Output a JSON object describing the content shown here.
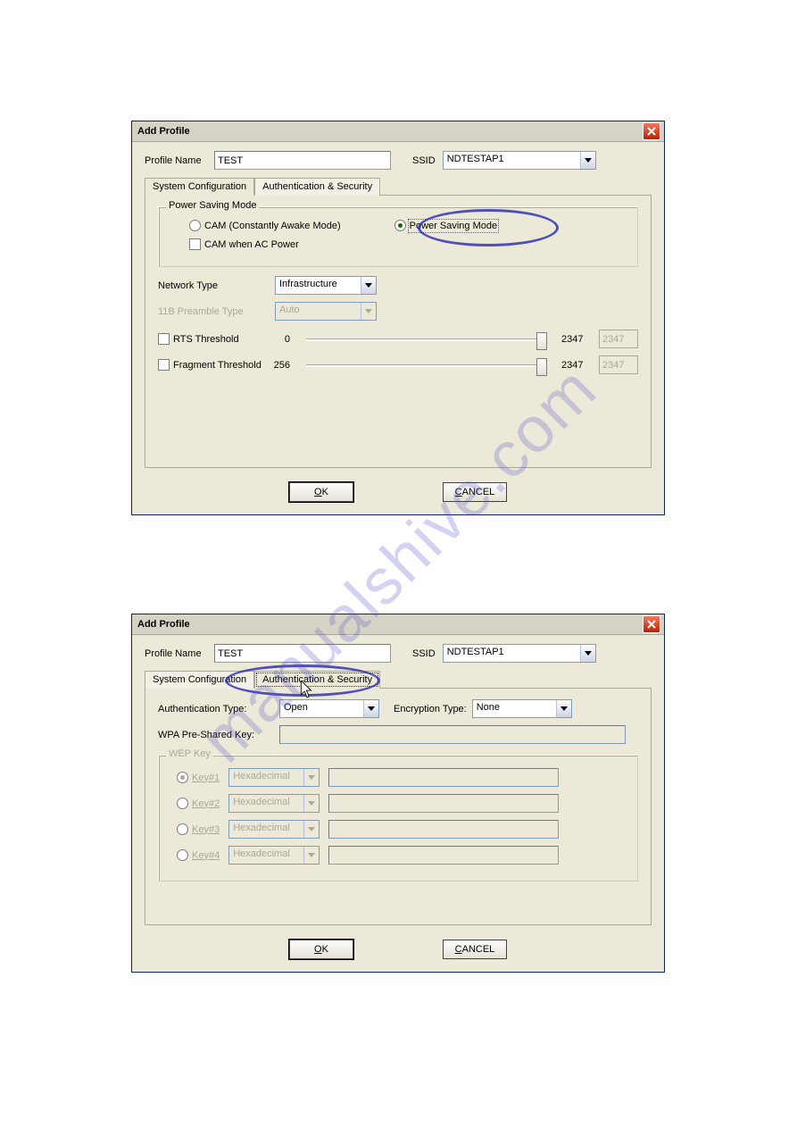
{
  "watermark": "manualshive.com",
  "dialog1": {
    "title": "Add Profile",
    "profile_name_label": "Profile Name",
    "profile_name_value": "TEST",
    "ssid_label": "SSID",
    "ssid_value": "NDTESTAP1",
    "tab_sysconf": "System Configuration",
    "tab_authsec": "Authentication & Security",
    "psm_group": "Power Saving Mode",
    "radio_cam": "CAM (Constantly Awake Mode)",
    "radio_psm": "Power Saving Mode",
    "chk_cam_ac": "CAM when AC Power",
    "network_type_label": "Network Type",
    "network_type_value": "Infrastructure",
    "preamble_label": "11B Preamble Type",
    "preamble_value": "Auto",
    "chk_rts": "RTS Threshold",
    "rts_min": "0",
    "rts_max": "2347",
    "rts_val": "2347",
    "chk_frag": "Fragment Threshold",
    "frag_min": "256",
    "frag_max": "2347",
    "frag_val": "2347",
    "ok_btn_pre": "O",
    "ok_btn_post": "K",
    "cancel_btn_pre": "C",
    "cancel_btn_post": "ANCEL"
  },
  "dialog2": {
    "title": "Add Profile",
    "profile_name_label": "Profile Name",
    "profile_name_value": "TEST",
    "ssid_label": "SSID",
    "ssid_value": "NDTESTAP1",
    "tab_sysconf": "System Configuration",
    "tab_authsec": "Authentication & Security",
    "auth_type_label": "Authentication Type:",
    "auth_type_value": "Open",
    "enc_type_label": "Encryption Type:",
    "enc_type_value": "None",
    "wpa_psk_label": "WPA Pre-Shared Key:",
    "wpa_psk_value": "",
    "wep_group": "WEP Key",
    "key1_label": "Key#1",
    "key2_label": "Key#2",
    "key3_label": "Key#3",
    "key4_label": "Key#4",
    "key_combo": "Hexadecimal",
    "ok_btn_pre": "O",
    "ok_btn_post": "K",
    "cancel_btn_pre": "C",
    "cancel_btn_post": "ANCEL"
  }
}
